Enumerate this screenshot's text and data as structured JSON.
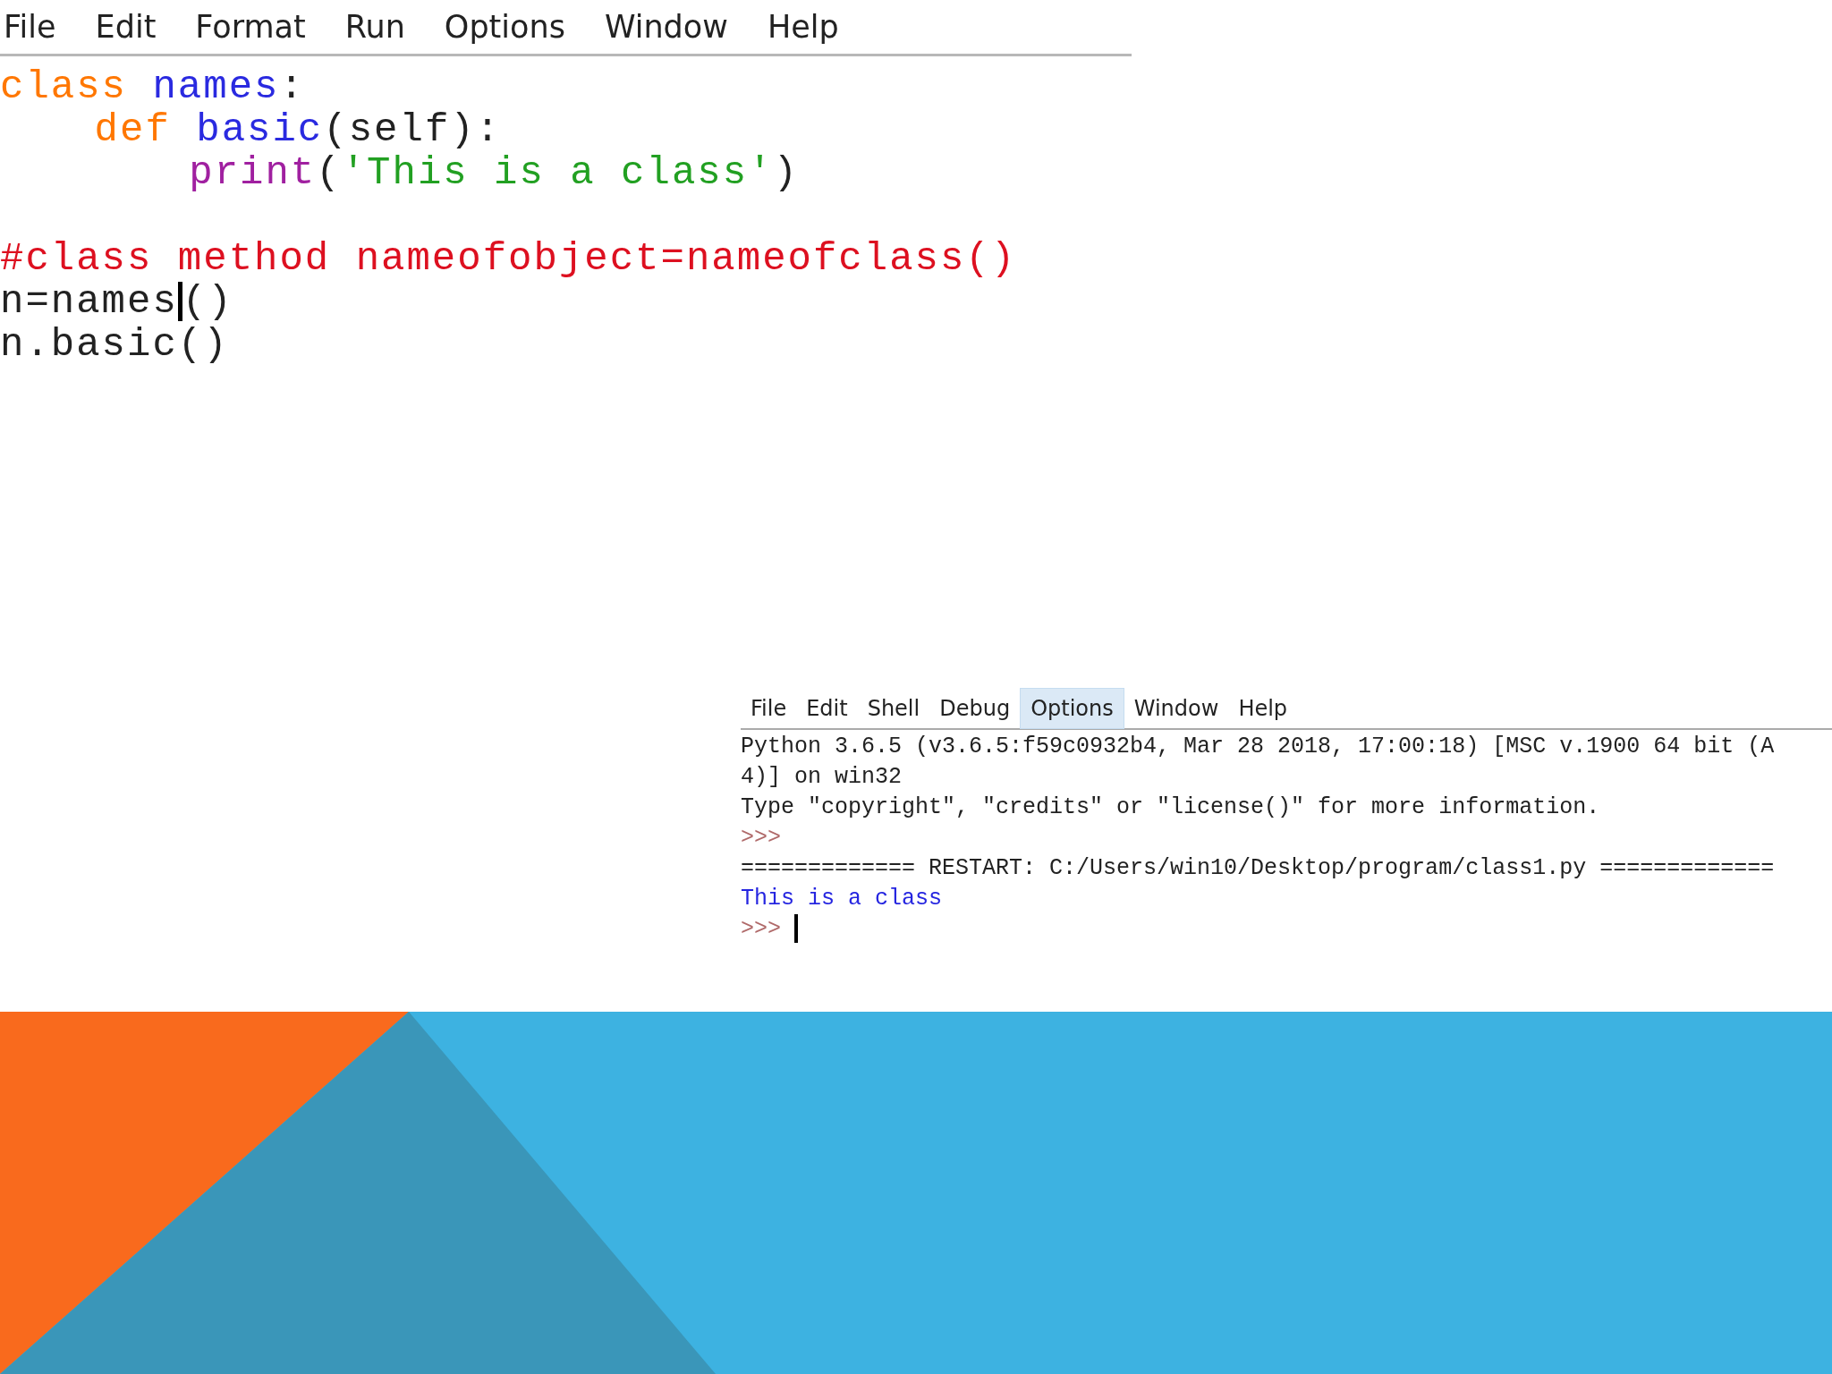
{
  "editor": {
    "menu": [
      {
        "label": "File"
      },
      {
        "label": "Edit"
      },
      {
        "label": "Format"
      },
      {
        "label": "Run"
      },
      {
        "label": "Options"
      },
      {
        "label": "Window"
      },
      {
        "label": "Help"
      }
    ],
    "blocks": [
      [
        {
          "tokens": [
            {
              "kind": "keyword",
              "text": "class"
            },
            {
              "kind": "definition",
              "text": " names"
            },
            {
              "kind": "plain",
              "text": ":"
            }
          ],
          "children": [
            {
              "tokens": [
                {
                  "kind": "keyword",
                  "text": "def"
                },
                {
                  "kind": "definition",
                  "text": " basic"
                },
                {
                  "kind": "plain",
                  "text": "(self):"
                }
              ],
              "children": [
                {
                  "tokens": [
                    {
                      "kind": "builtin",
                      "text": "print"
                    },
                    {
                      "kind": "plain",
                      "text": "("
                    },
                    {
                      "kind": "string",
                      "text": "'This is a class'"
                    },
                    {
                      "kind": "plain",
                      "text": ")"
                    }
                  ]
                }
              ]
            }
          ]
        }
      ],
      [
        {
          "tokens": [
            {
              "kind": "comment",
              "text": "#class method nameofobject=nameofclass()"
            }
          ]
        },
        {
          "tokens": [
            {
              "kind": "plain",
              "text": "n=names"
            },
            {
              "kind": "cursor"
            },
            {
              "kind": "plain",
              "text": "()"
            }
          ]
        },
        {
          "tokens": [
            {
              "kind": "plain",
              "text": "n.basic()"
            }
          ]
        }
      ]
    ]
  },
  "shell": {
    "menu": [
      {
        "label": "File",
        "selected": false
      },
      {
        "label": "Edit",
        "selected": false
      },
      {
        "label": "Shell",
        "selected": false
      },
      {
        "label": "Debug",
        "selected": false
      },
      {
        "label": "Options",
        "selected": true
      },
      {
        "label": "Window",
        "selected": false
      },
      {
        "label": "Help",
        "selected": false
      }
    ],
    "lines": [
      [
        {
          "kind": "plain",
          "text": "Python 3.6.5 (v3.6.5:f59c0932b4, Mar 28 2018, 17:00:18) [MSC v.1900 64 bit (A"
        }
      ],
      [
        {
          "kind": "plain",
          "text": "4)] on win32"
        }
      ],
      [
        {
          "kind": "plain",
          "text": "Type \"copyright\", \"credits\" or \"license()\" for more information."
        }
      ],
      [
        {
          "kind": "prompt",
          "text": ">>>"
        }
      ],
      [
        {
          "kind": "plain",
          "text": "============= RESTART: C:/Users/win10/Desktop/program/class1.py ============="
        }
      ],
      [
        {
          "kind": "stdout",
          "text": "This is a class"
        }
      ],
      [
        {
          "kind": "prompt",
          "text": ">>> "
        },
        {
          "kind": "cursor"
        }
      ]
    ]
  }
}
